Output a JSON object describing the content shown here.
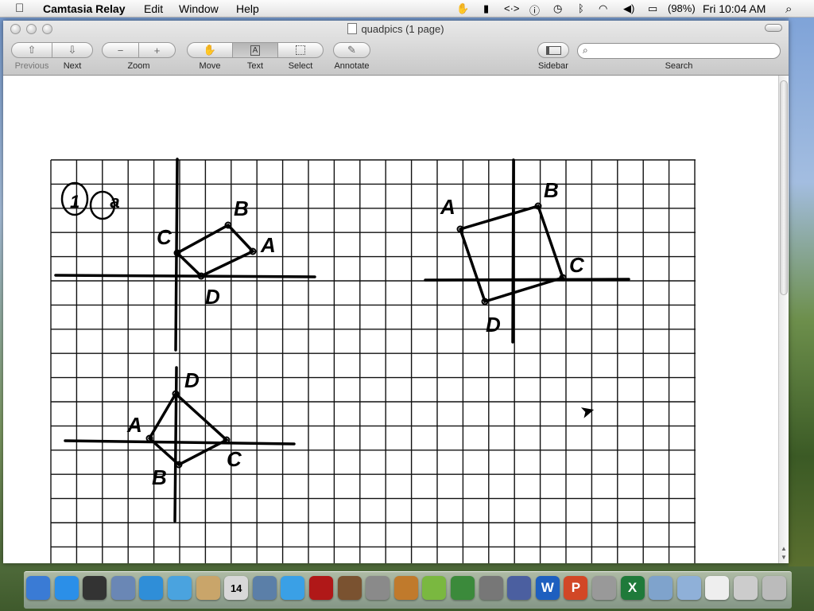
{
  "menubar": {
    "app_name": "Camtasia Relay",
    "menus": [
      "Edit",
      "Window",
      "Help"
    ],
    "battery": "(98%)",
    "clock": "Fri 10:04 AM"
  },
  "window": {
    "title": "quadpics (1 page)",
    "toolbar": {
      "previous_label": "Previous",
      "next_label": "Next",
      "zoom_label": "Zoom",
      "zoom_out_glyph": "−",
      "zoom_in_glyph": "+",
      "move_label": "Move",
      "text_label": "Text",
      "select_label": "Select",
      "annotate_label": "Annotate",
      "sidebar_label": "Sidebar",
      "search_label": "Search",
      "search_value": ""
    }
  },
  "document": {
    "header_mark": "1 a",
    "figures": [
      {
        "labels": [
          "A",
          "B",
          "C",
          "D"
        ]
      },
      {
        "labels": [
          "A",
          "B",
          "C",
          "D"
        ]
      },
      {
        "labels": [
          "A",
          "B",
          "C",
          "D"
        ]
      }
    ]
  },
  "dock": {
    "icons": [
      "finder-icon",
      "app-store-icon",
      "dashboard-icon",
      "mail-icon",
      "safari-icon",
      "ichat-icon",
      "address-book-icon",
      "ical-icon",
      "iphoto-icon",
      "itunes-icon",
      "photo-booth-icon",
      "iphoto-camera-icon",
      "imovie-icon",
      "garageband-icon",
      "preview-icon",
      "time-machine-icon",
      "system-preferences-icon",
      "camtasia-icon",
      "word-icon",
      "powerpoint-icon",
      "stopwatch-icon",
      "excel-icon",
      "applications-folder-icon",
      "documents-folder-icon",
      "file-icon",
      "keyboard-icon",
      "trash-icon"
    ],
    "ical_day": "14"
  }
}
